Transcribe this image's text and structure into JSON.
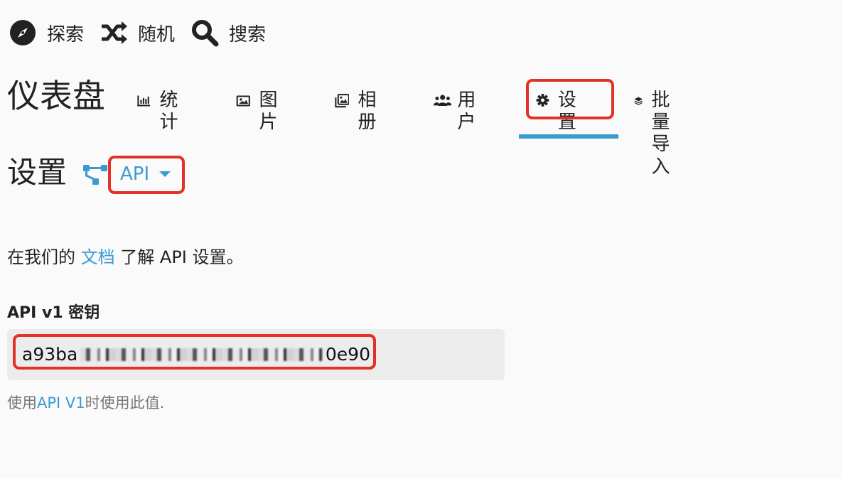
{
  "top_nav": [
    {
      "label": "探索",
      "icon": "compass-icon"
    },
    {
      "label": "随机",
      "icon": "shuffle-icon"
    },
    {
      "label": "搜索",
      "icon": "search-icon"
    }
  ],
  "dashboard": {
    "title": "仪表盘",
    "active_tab": "设置",
    "tabs": [
      {
        "label": "统计",
        "icon": "bar-chart-icon"
      },
      {
        "label": "图片",
        "icon": "image-icon"
      },
      {
        "label": "相册",
        "icon": "albums-icon"
      },
      {
        "label": "用户",
        "icon": "users-icon"
      },
      {
        "label": "设置",
        "icon": "gear-icon"
      },
      {
        "label": "批量导入",
        "icon": "layers-icon"
      }
    ]
  },
  "settings": {
    "title": "设置",
    "section_icon": "sitemap-icon",
    "selected_section": "API",
    "doc_line": {
      "before": "在我们的 ",
      "link": "文档",
      "after": " 了解 API 设置。"
    },
    "api_key": {
      "label": "API v1 密钥",
      "value_start": "a93ba",
      "value_end": "0e90",
      "hint_before": "使用",
      "hint_link": "API V1",
      "hint_after": "时使用此值."
    }
  },
  "colors": {
    "accent": "#3a9bd1",
    "highlight": "#e23127",
    "key_background": "#ececec"
  }
}
